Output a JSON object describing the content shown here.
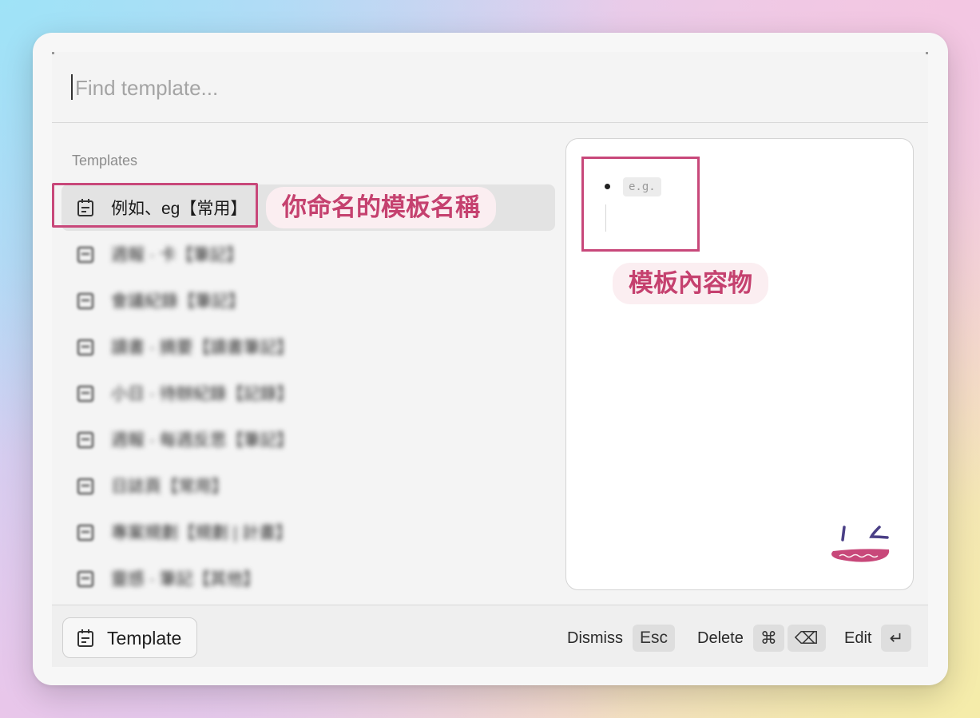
{
  "search": {
    "placeholder": "Find template..."
  },
  "section_label": "Templates",
  "templates": [
    {
      "label": "例如、eg【常用】",
      "selected": true
    },
    {
      "label": "週報 · 卡【筆記】"
    },
    {
      "label": "會議紀錄【筆記】"
    },
    {
      "label": "讀書 · 摘要【讀書筆記】"
    },
    {
      "label": "小日 · 待辦紀錄【記錄】"
    },
    {
      "label": "週報 · 每週反思【筆記】"
    },
    {
      "label": "日誌頁【常用】"
    },
    {
      "label": "專案規劃【規劃 | 計畫】"
    },
    {
      "label": "靈感 · 筆記【其他】"
    }
  ],
  "annotations": {
    "name_callout": "你命名的模板名稱",
    "content_callout": "模板內容物"
  },
  "preview": {
    "code_chip": "e.g."
  },
  "footer": {
    "template_button": "Template",
    "dismiss_label": "Dismiss",
    "dismiss_key": "Esc",
    "delete_label": "Delete",
    "delete_key_1": "⌘",
    "delete_key_2": "⌫",
    "edit_label": "Edit",
    "edit_key": "↵"
  },
  "colors": {
    "accent": "#c8487a",
    "pill_bg": "#fbeef1"
  }
}
